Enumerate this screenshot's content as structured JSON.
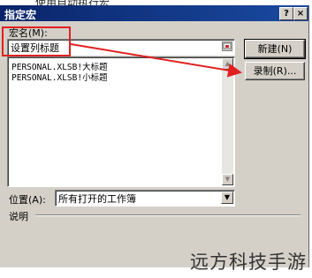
{
  "background_text": "使用自动执行宏",
  "dialog": {
    "title": "指定宏",
    "help_button": "?",
    "close_button": "×"
  },
  "macro_name": {
    "label": "宏名(M):",
    "value": "设置列标题",
    "picker_icon": "range-picker-icon"
  },
  "macro_list": {
    "items": [
      "PERSONAL.XLSB!大标题",
      "PERSONAL.XLSB!小标题"
    ]
  },
  "buttons": {
    "new": "新建(N)",
    "record": "录制(R)..."
  },
  "location": {
    "label": "位置(A):",
    "value": "所有打开的工作簿"
  },
  "description": {
    "label": "说明"
  },
  "annotation": {
    "color": "#e02020"
  },
  "watermark": "远方科技手游"
}
